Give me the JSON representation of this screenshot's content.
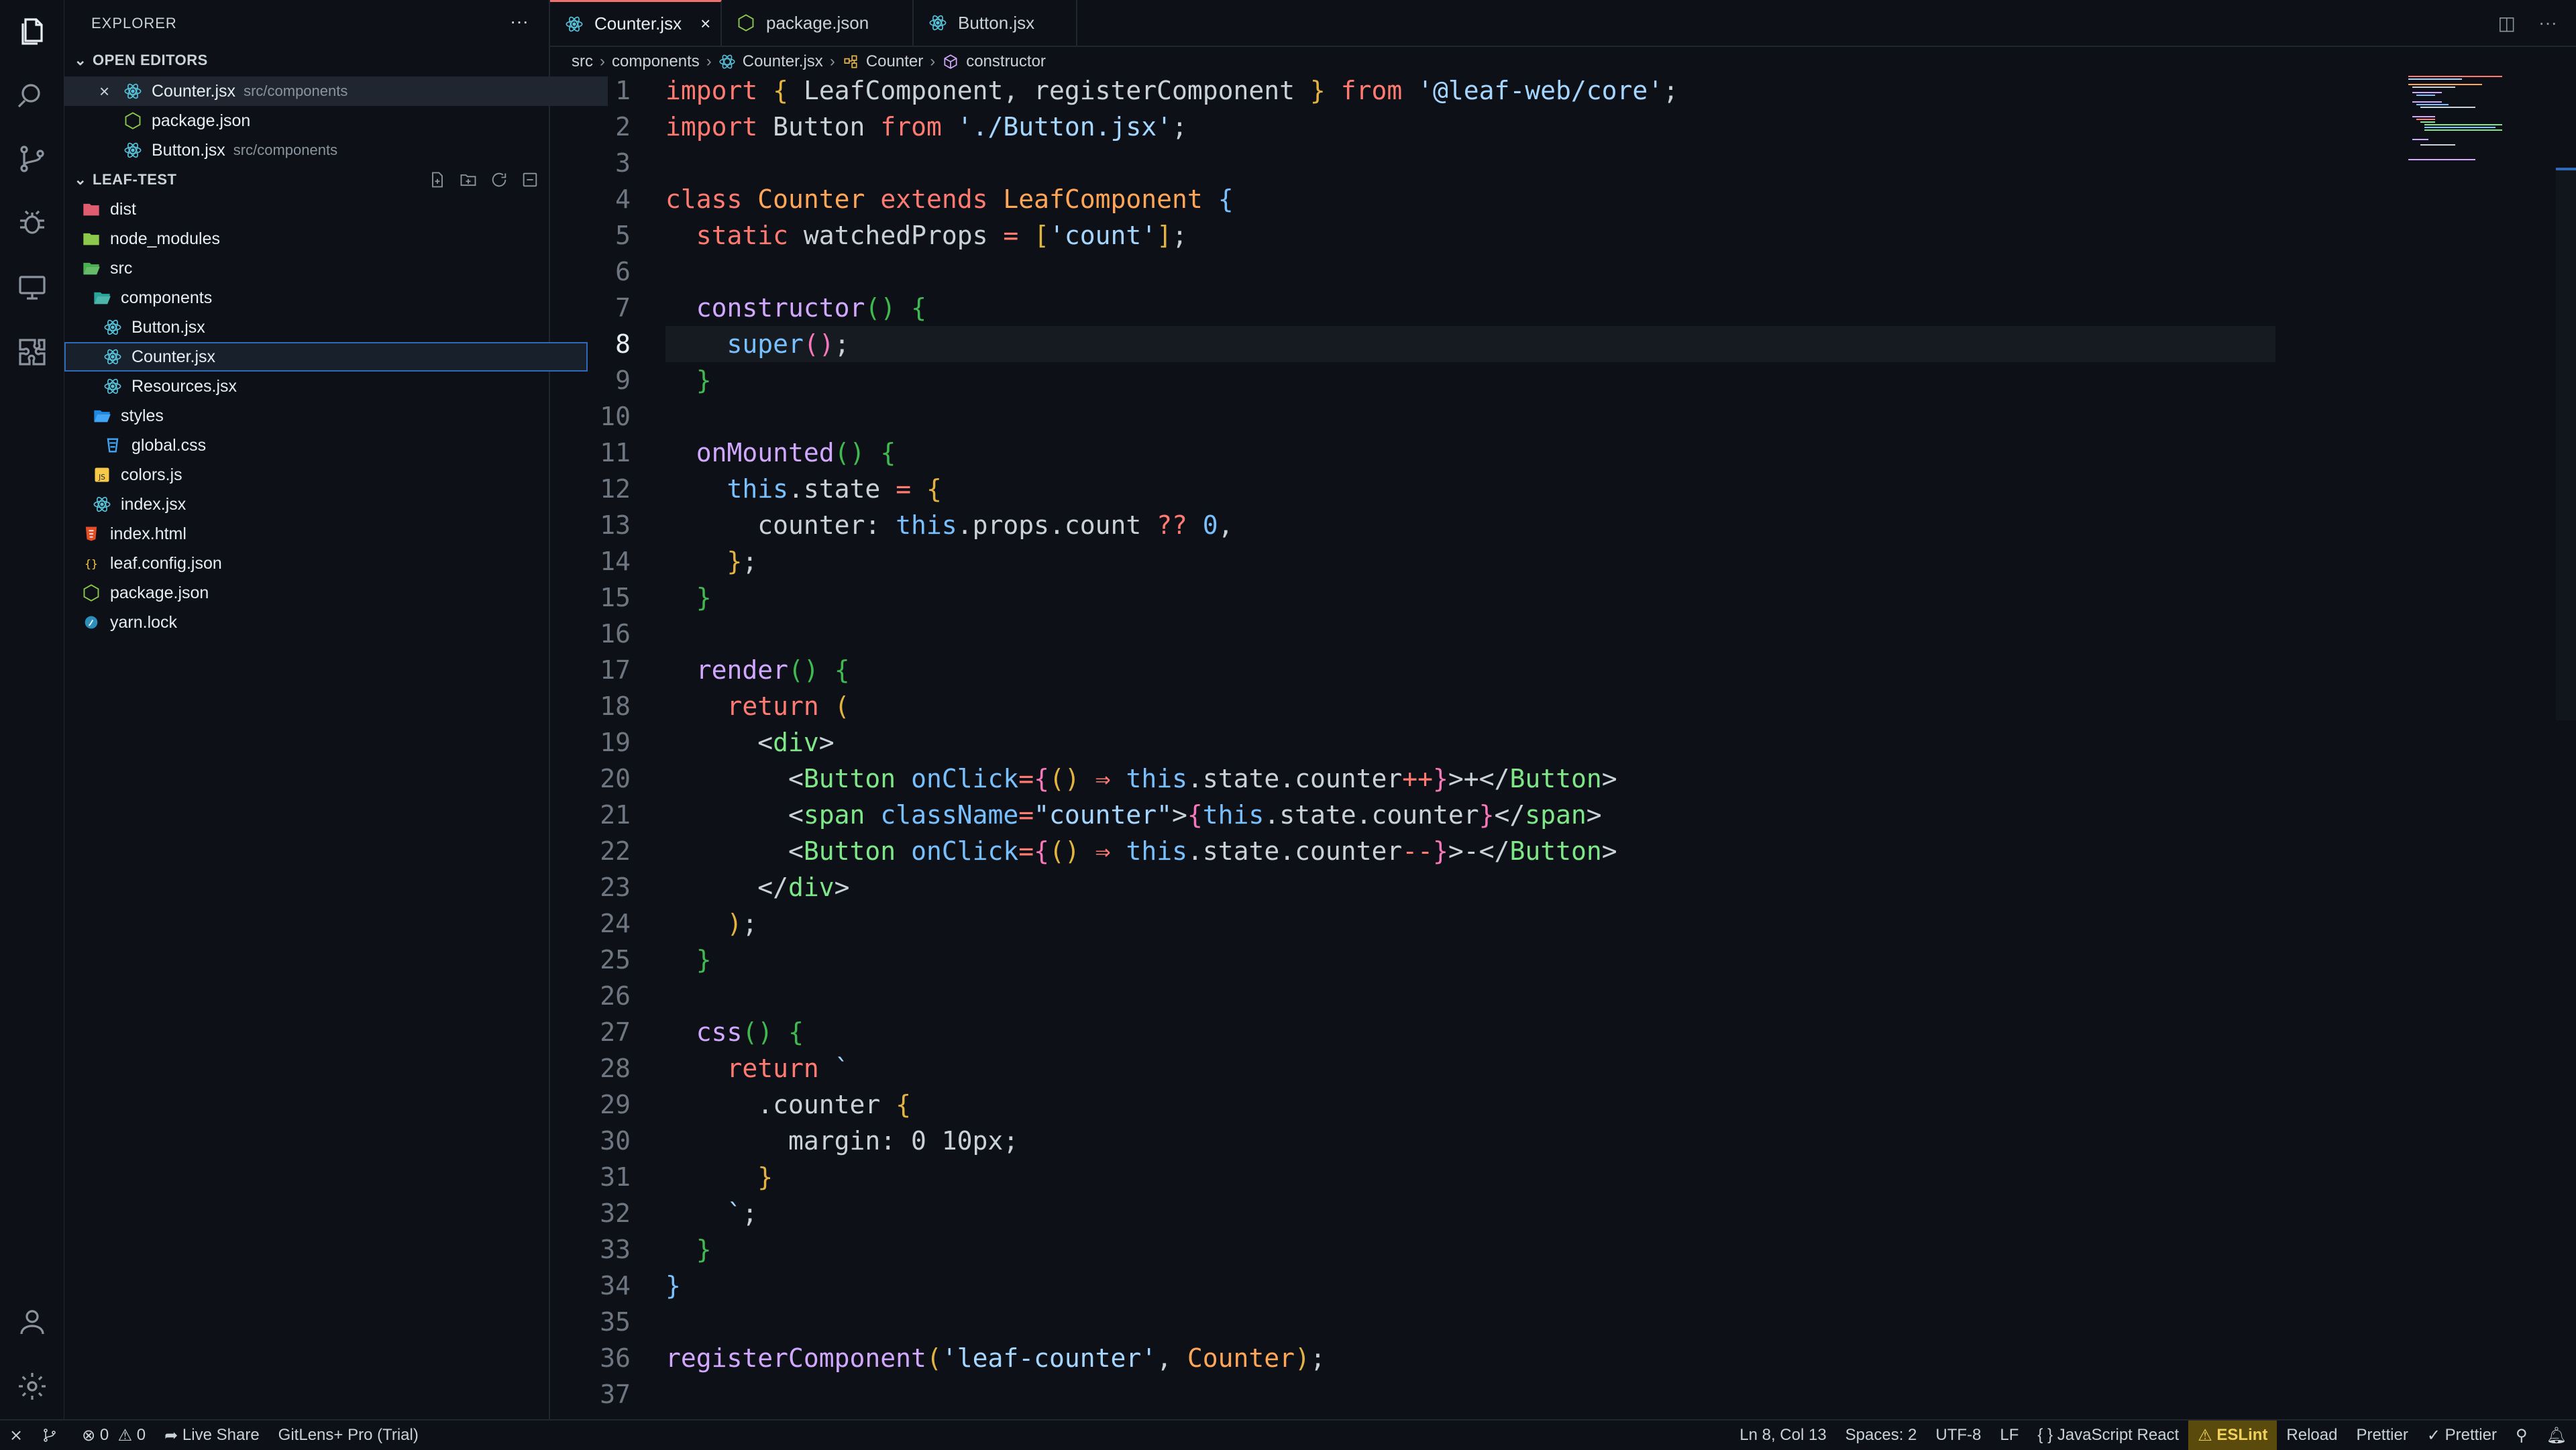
{
  "sidebar": {
    "title": "EXPLORER",
    "more": "···",
    "open_editors": {
      "label": "OPEN EDITORS",
      "items": [
        {
          "name": "Counter.jsx",
          "path": "src/components"
        },
        {
          "name": "package.json",
          "path": ""
        },
        {
          "name": "Button.jsx",
          "path": "src/components"
        }
      ]
    },
    "project": {
      "label": "LEAF-TEST",
      "items": [
        {
          "name": "dist"
        },
        {
          "name": "node_modules"
        },
        {
          "name": "src"
        },
        {
          "name": "components"
        },
        {
          "name": "Button.jsx"
        },
        {
          "name": "Counter.jsx"
        },
        {
          "name": "Resources.jsx"
        },
        {
          "name": "styles"
        },
        {
          "name": "global.css"
        },
        {
          "name": "colors.js"
        },
        {
          "name": "index.jsx"
        },
        {
          "name": "index.html"
        },
        {
          "name": "leaf.config.json"
        },
        {
          "name": "package.json"
        },
        {
          "name": "yarn.lock"
        }
      ]
    }
  },
  "tabs": [
    {
      "label": "Counter.jsx",
      "close": "×"
    },
    {
      "label": "package.json"
    },
    {
      "label": "Button.jsx"
    }
  ],
  "tab_tools": {
    "split": "◫",
    "more": "···"
  },
  "breadcrumb": {
    "items": [
      "src",
      "components",
      "Counter.jsx",
      "Counter",
      "constructor"
    ],
    "sep": "›"
  },
  "editor": {
    "current_line": 8,
    "line_numbers": [
      "1",
      "2",
      "3",
      "4",
      "5",
      "6",
      "7",
      "8",
      "9",
      "10",
      "11",
      "12",
      "13",
      "14",
      "15",
      "16",
      "17",
      "18",
      "19",
      "20",
      "21",
      "22",
      "23",
      "24",
      "25",
      "26",
      "27",
      "28",
      "29",
      "30",
      "31",
      "32",
      "33",
      "34",
      "35",
      "36",
      "37"
    ]
  },
  "status": {
    "problems": "0",
    "warnings": "0",
    "live_share": "Live Share",
    "gitlens": "GitLens+ Pro (Trial)",
    "position": "Ln 8, Col 13",
    "spaces": "Spaces: 2",
    "encoding": "UTF-8",
    "eol": "LF",
    "language": "JavaScript React",
    "eslint": "ESLint",
    "reload": "Reload",
    "prettier1": "Prettier",
    "prettier2": "Prettier"
  },
  "colors": {
    "accent_tab": "#ef6f6c",
    "selection_outline": "#2f6ab8",
    "eslint_bg": "#5a4a0c"
  }
}
